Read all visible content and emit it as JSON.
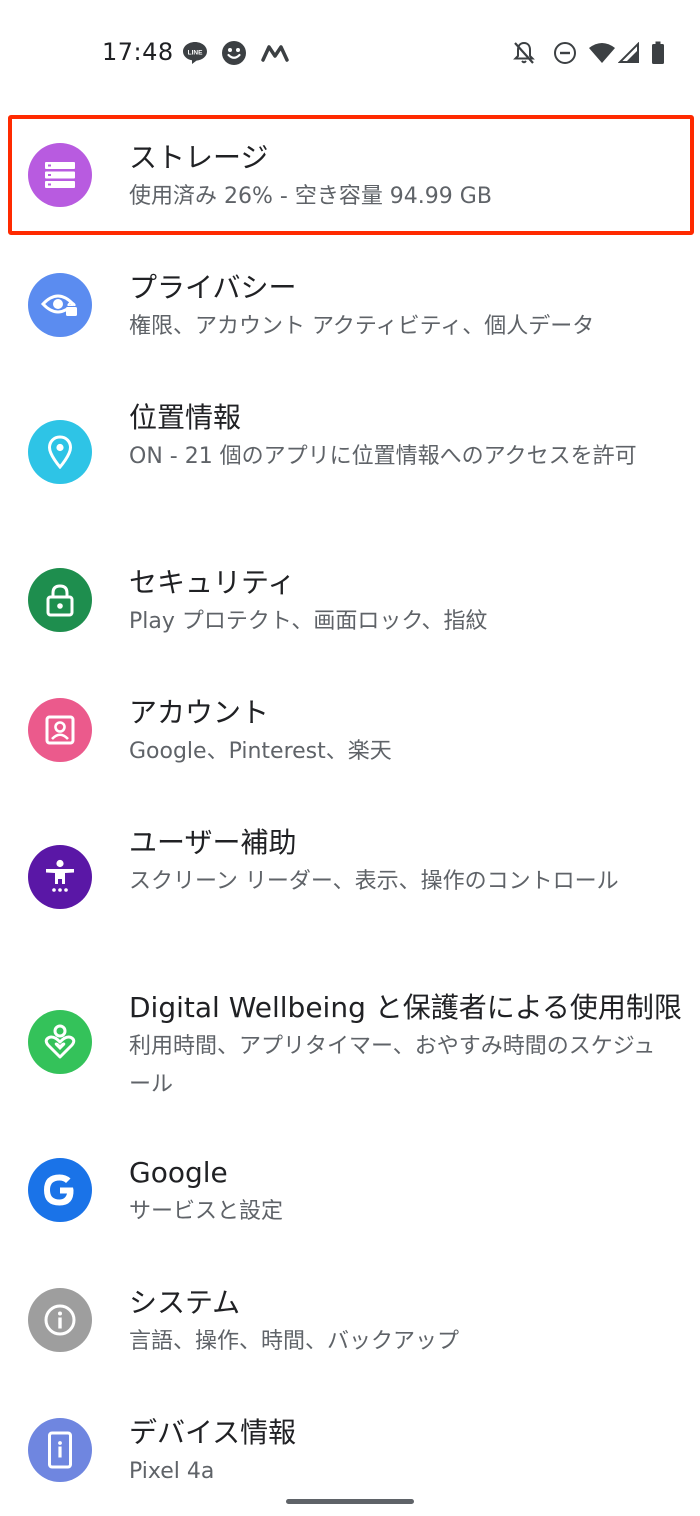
{
  "status_bar": {
    "time": "17:48",
    "left_icons": [
      "line-icon",
      "smiley-icon",
      "m-app-icon"
    ],
    "right_icons": [
      "notifications-off-icon",
      "do-not-disturb-icon",
      "wifi-icon",
      "cellular-signal-icon",
      "battery-icon"
    ]
  },
  "highlight": {
    "target": "storage",
    "color": "#ff2a00"
  },
  "settings": {
    "items": [
      {
        "id": "storage",
        "title": "ストレージ",
        "subtitle": "使用済み 26% - 空き容量 94.99 GB",
        "icon": "storage-icon",
        "icon_color": "#b85be0"
      },
      {
        "id": "privacy",
        "title": "プライバシー",
        "subtitle": "権限、アカウント アクティビティ、個人データ",
        "icon": "privacy-eye-icon",
        "icon_color": "#5b8cf0"
      },
      {
        "id": "location",
        "title": "位置情報",
        "subtitle": "ON - 21 個のアプリに位置情報へのアクセスを許可",
        "icon": "location-pin-icon",
        "icon_color": "#2ec4e6"
      },
      {
        "id": "security",
        "title": "セキュリティ",
        "subtitle": "Play プロテクト、画面ロック、指紋",
        "icon": "lock-icon",
        "icon_color": "#1e8e4e"
      },
      {
        "id": "accounts",
        "title": "アカウント",
        "subtitle": "Google、Pinterest、楽天",
        "icon": "account-icon",
        "icon_color": "#eb5a8c"
      },
      {
        "id": "accessibility",
        "title": "ユーザー補助",
        "subtitle": "スクリーン リーダー、表示、操作のコントロール",
        "icon": "accessibility-icon",
        "icon_color": "#5a17a6"
      },
      {
        "id": "wellbeing",
        "title": "Digital Wellbeing と保護者による使用制限",
        "subtitle": "利用時間、アプリタイマー、おやすみ時間のスケジュール",
        "icon": "wellbeing-heart-icon",
        "icon_color": "#34c25a"
      },
      {
        "id": "google",
        "title": "Google",
        "subtitle": "サービスと設定",
        "icon": "google-g-icon",
        "icon_color": "#1a73e8"
      },
      {
        "id": "system",
        "title": "システム",
        "subtitle": "言語、操作、時間、バックアップ",
        "icon": "info-icon",
        "icon_color": "#9e9e9e"
      },
      {
        "id": "about",
        "title": "デバイス情報",
        "subtitle": "Pixel 4a",
        "icon": "phone-info-icon",
        "icon_color": "#6f86e0"
      }
    ]
  }
}
